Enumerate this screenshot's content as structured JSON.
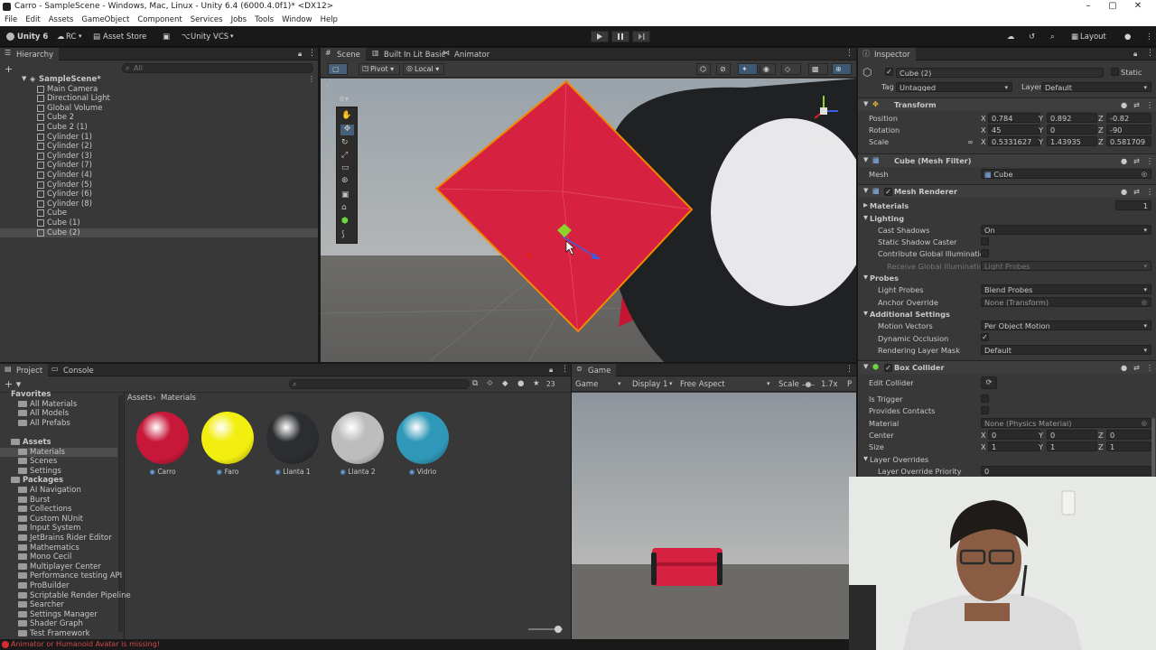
{
  "window": {
    "title": "Carro - SampleScene - Windows, Mac, Linux - Unity 6.4 (6000.4.0f1)* <DX12>"
  },
  "menu": [
    "File",
    "Edit",
    "Assets",
    "GameObject",
    "Component",
    "Services",
    "Jobs",
    "Tools",
    "Window",
    "Help"
  ],
  "toolbar": {
    "account": "Unity 6",
    "rc": "RC",
    "asset_store": "Asset Store",
    "vcs": "Unity VCS",
    "layout": "Layout"
  },
  "hierarchy": {
    "tab": "Hierarchy",
    "search_placeholder": "All",
    "scene": "SampleScene*",
    "items": [
      "Main Camera",
      "Directional Light",
      "Global Volume",
      "Cube 2",
      "Cube 2 (1)",
      "Cylinder (1)",
      "Cylinder (2)",
      "Cylinder (3)",
      "Cylinder (7)",
      "Cylinder (4)",
      "Cylinder (5)",
      "Cylinder (6)",
      "Cylinder (8)",
      "Cube",
      "Cube (1)",
      "Cube (2)"
    ],
    "selected_index": 15
  },
  "scene_view": {
    "tabs": [
      "Scene",
      "Built In Lit Basic",
      "Animator"
    ],
    "pivot": "Pivot",
    "local": "Local",
    "persp": "Persp"
  },
  "inspector": {
    "tab": "Inspector",
    "object_name": "Cube (2)",
    "static": "Static",
    "tag_label": "Tag",
    "tag": "Untagged",
    "layer_label": "Layer",
    "layer": "Default",
    "transform": {
      "title": "Transform",
      "position_label": "Position",
      "position": {
        "x": "0.784",
        "y": "0.892",
        "z": "-0.82"
      },
      "rotation_label": "Rotation",
      "rotation": {
        "x": "45",
        "y": "0",
        "z": "-90"
      },
      "scale_label": "Scale",
      "scale": {
        "x": "0.5331627",
        "y": "1.43935",
        "z": "0.581709"
      }
    },
    "mesh_filter": {
      "title": "Cube (Mesh Filter)",
      "mesh_label": "Mesh",
      "mesh": "Cube"
    },
    "mesh_renderer": {
      "title": "Mesh Renderer",
      "materials": "Materials",
      "materials_count": "1",
      "lighting": "Lighting",
      "cast_shadows_label": "Cast Shadows",
      "cast_shadows": "On",
      "static_shadow_caster": "Static Shadow Caster",
      "contribute_gi": "Contribute Global Illumination",
      "receive_gi_label": "Receive Global Illumination",
      "receive_gi": "Light Probes",
      "probes": "Probes",
      "light_probes_label": "Light Probes",
      "light_probes": "Blend Probes",
      "anchor_override_label": "Anchor Override",
      "anchor_override": "None (Transform)",
      "additional": "Additional Settings",
      "motion_vectors_label": "Motion Vectors",
      "motion_vectors": "Per Object Motion",
      "dynamic_occlusion": "Dynamic Occlusion",
      "rendering_layer_label": "Rendering Layer Mask",
      "rendering_layer": "Default"
    },
    "box_collider": {
      "title": "Box Collider",
      "edit_collider": "Edit Collider",
      "is_trigger": "Is Trigger",
      "provides_contacts": "Provides Contacts",
      "material_label": "Material",
      "material": "None (Physics Material)",
      "center_label": "Center",
      "center": {
        "x": "0",
        "y": "0",
        "z": "0"
      },
      "size_label": "Size",
      "size": {
        "x": "1",
        "y": "1",
        "z": "1"
      },
      "layer_overrides": "Layer Overrides",
      "layer_override_priority_label": "Layer Override Priority",
      "layer_override_priority": "0"
    }
  },
  "project": {
    "tabs": [
      "Project",
      "Console"
    ],
    "count": "23",
    "breadcrumb": [
      "Assets",
      "Materials"
    ],
    "favorites_label": "Favorites",
    "favorites": [
      "All Materials",
      "All Models",
      "All Prefabs"
    ],
    "assets_label": "Assets",
    "assets": [
      "Materials",
      "Scenes",
      "Settings"
    ],
    "packages_label": "Packages",
    "packages": [
      "AI Navigation",
      "Burst",
      "Collections",
      "Custom NUnit",
      "Input System",
      "JetBrains Rider Editor",
      "Mathematics",
      "Mono Cecil",
      "Multiplayer Center",
      "Performance testing API",
      "ProBuilder",
      "Scriptable Render Pipeline",
      "Searcher",
      "Settings Manager",
      "Shader Graph",
      "Test Framework"
    ],
    "materials": [
      {
        "name": "Carro",
        "color": "#c8183a"
      },
      {
        "name": "Faro",
        "color": "#f2ee10"
      },
      {
        "name": "Llanta 1",
        "color": "#2b2d30"
      },
      {
        "name": "Llanta 2",
        "color": "#bdbdbd"
      },
      {
        "name": "Vidrio",
        "color": "#2f98b8"
      }
    ]
  },
  "game_view": {
    "tab": "Game",
    "mode": "Game",
    "display": "Display 1",
    "aspect": "Free Aspect",
    "scale_label": "Scale",
    "scale": "1.7x"
  },
  "status": {
    "message": "Animator or Humanoid Avatar is missing!"
  },
  "colors": {
    "accent": "#3d78d8",
    "selection": "#4d4d4d",
    "car_body": "#d62140"
  }
}
